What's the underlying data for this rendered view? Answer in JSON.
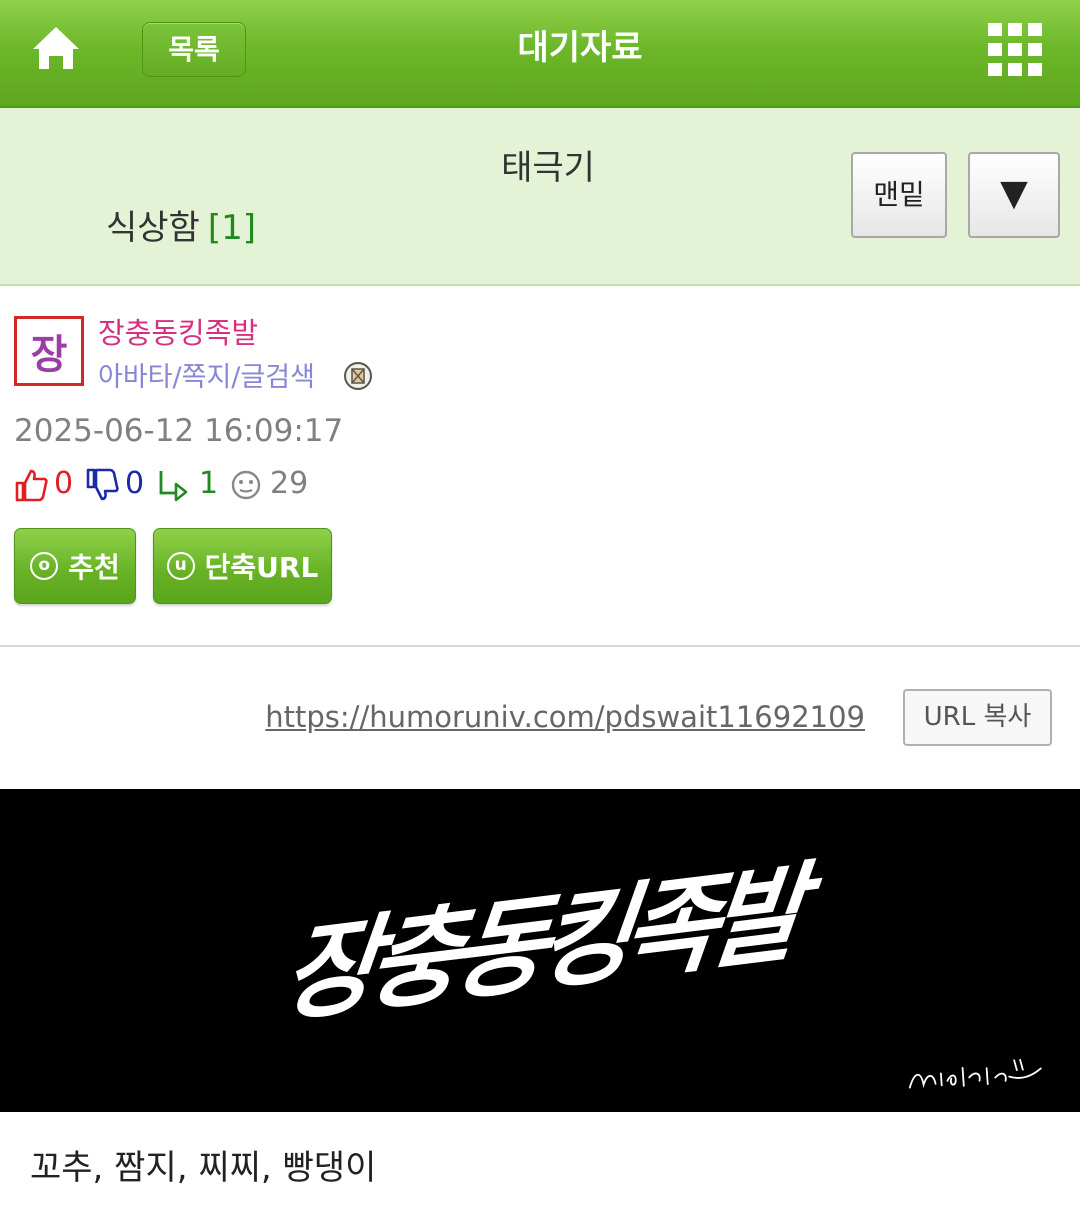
{
  "header": {
    "list_label": "목록",
    "title": "대기자료"
  },
  "subject": {
    "title": "태극기",
    "line2": "식상함",
    "comment_count": "[1]",
    "bottom_label": "맨밑",
    "down_label": "▼"
  },
  "author": {
    "avatar_char": "장",
    "name": "장충동킹족발",
    "links": "아바타/쪽지/글검색"
  },
  "post": {
    "date": "2025-06-12 16:09:17",
    "stats": {
      "likes": "0",
      "dislikes": "0",
      "replies": "1",
      "views": "29"
    },
    "recommend_icon": "o",
    "recommend_label": "추천",
    "shorturl_icon": "u",
    "shorturl_label": "단축URL",
    "url": "https://humoruniv.com/pdswait11692109",
    "copy_label": "URL 복사",
    "image_text": "장충동킹족발",
    "body": "꼬추, 짬지, 찌찌, 빵댕이"
  },
  "colors": {
    "header_green": "#6db72a",
    "subject_bg": "#e4f3d5",
    "author_name": "#d6307f",
    "author_links": "#8a86d6",
    "like": "#e02020",
    "dislike": "#1a2aa8",
    "reply": "#1f8a1f"
  },
  "icons": [
    "home-icon",
    "grid-menu-icon",
    "letter-icon",
    "thumbs-up-icon",
    "thumbs-down-icon",
    "reply-icon",
    "smiley-icon"
  ]
}
